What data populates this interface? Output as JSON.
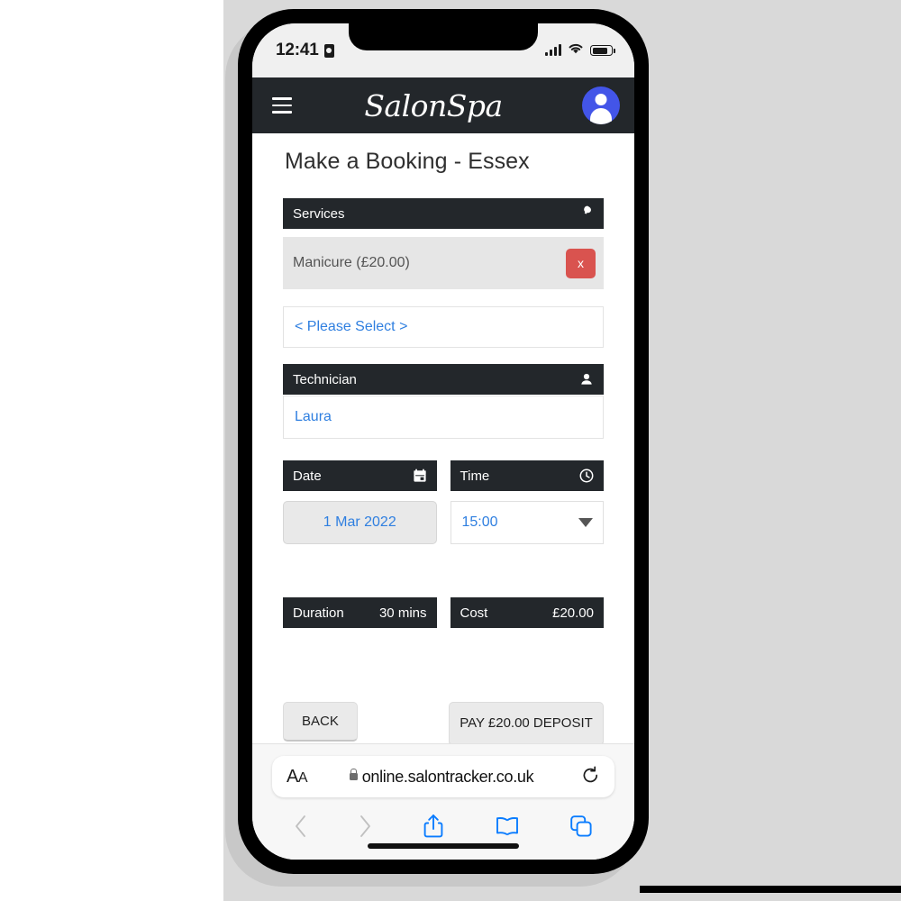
{
  "status_bar": {
    "time": "12:41",
    "recording_icon": "recording-indicator-icon",
    "signal_icon": "cellular-signal-icon",
    "wifi_icon": "wifi-icon",
    "battery_icon": "battery-icon"
  },
  "site_header": {
    "menu_icon": "hamburger-menu-icon",
    "brand": "SalonSpa",
    "account_icon": "user-avatar-icon"
  },
  "page": {
    "title": "Make a Booking - Essex"
  },
  "services": {
    "header_label": "Services",
    "header_icon": "nail-polish-icon",
    "selected": [
      {
        "label": "Manicure (£20.00)",
        "remove_label": "x"
      }
    ],
    "add_select_value": "< Please Select >"
  },
  "technician": {
    "header_label": "Technician",
    "header_icon": "person-icon",
    "value": "Laura"
  },
  "date": {
    "header_label": "Date",
    "header_icon": "calendar-icon",
    "value": "1 Mar 2022"
  },
  "time": {
    "header_label": "Time",
    "header_icon": "clock-icon",
    "value": "15:00",
    "caret_icon": "chevron-down-icon"
  },
  "summary": {
    "duration_label": "Duration",
    "duration_value": "30 mins",
    "cost_label": "Cost",
    "cost_value": "£20.00"
  },
  "actions": {
    "back_label": "BACK",
    "pay_label": "PAY £20.00 DEPOSIT"
  },
  "safari": {
    "text_size_label": "AA",
    "lock_icon": "lock-icon",
    "url": "online.salontracker.co.uk",
    "reload_icon": "reload-icon",
    "back_icon": "chevron-left-icon",
    "forward_icon": "chevron-right-icon",
    "share_icon": "share-icon",
    "bookmarks_icon": "book-icon",
    "tabs_icon": "tabs-icon"
  },
  "colors": {
    "header_dark": "#23272b",
    "accent_blue": "#2f7fe0",
    "avatar_blue": "#4355e8",
    "remove_red": "#d9534f",
    "safari_blue": "#0a7cff",
    "backdrop_grey": "#d9d9d9"
  }
}
